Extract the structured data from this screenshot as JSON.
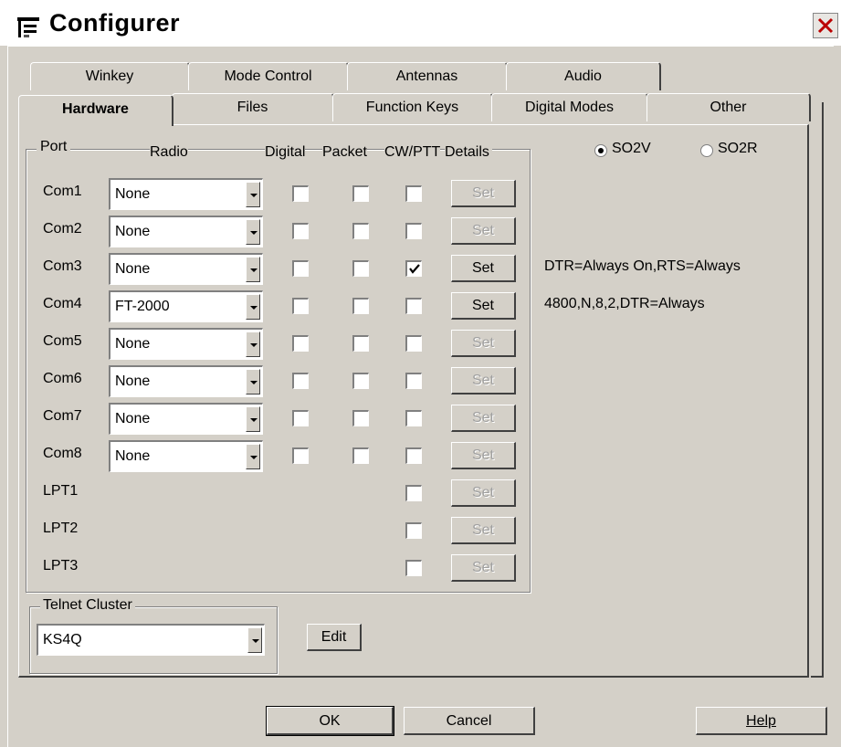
{
  "window": {
    "title": "Configurer",
    "icon": "app-icon"
  },
  "tabs": {
    "back_row": [
      "Winkey",
      "Mode Control",
      "Antennas",
      "Audio"
    ],
    "front_row": [
      "Hardware",
      "Files",
      "Function Keys",
      "Digital Modes",
      "Other"
    ],
    "active": "Hardware"
  },
  "ports_group": {
    "headers": {
      "port": "Port",
      "radio": "Radio",
      "digital": "Digital",
      "packet": "Packet",
      "cwptt": "CW/PTT",
      "details": "Details"
    },
    "rows": [
      {
        "port": "Com1",
        "radio": "None",
        "digital": false,
        "packet": false,
        "cwptt": false,
        "enabled": false,
        "set": "Set",
        "details": ""
      },
      {
        "port": "Com2",
        "radio": "None",
        "digital": false,
        "packet": false,
        "cwptt": false,
        "enabled": false,
        "set": "Set",
        "details": ""
      },
      {
        "port": "Com3",
        "radio": "None",
        "digital": false,
        "packet": false,
        "cwptt": true,
        "enabled": true,
        "set": "Set",
        "details": "DTR=Always On,RTS=Always"
      },
      {
        "port": "Com4",
        "radio": "FT-2000",
        "digital": false,
        "packet": false,
        "cwptt": false,
        "enabled": true,
        "set": "Set",
        "details": "4800,N,8,2,DTR=Always"
      },
      {
        "port": "Com5",
        "radio": "None",
        "digital": false,
        "packet": false,
        "cwptt": false,
        "enabled": false,
        "set": "Set",
        "details": ""
      },
      {
        "port": "Com6",
        "radio": "None",
        "digital": false,
        "packet": false,
        "cwptt": false,
        "enabled": false,
        "set": "Set",
        "details": ""
      },
      {
        "port": "Com7",
        "radio": "None",
        "digital": false,
        "packet": false,
        "cwptt": false,
        "enabled": false,
        "set": "Set",
        "details": ""
      },
      {
        "port": "Com8",
        "radio": "None",
        "digital": false,
        "packet": false,
        "cwptt": false,
        "enabled": false,
        "set": "Set",
        "details": ""
      },
      {
        "port": "LPT1",
        "cwptt": false,
        "enabled": false,
        "set": "Set"
      },
      {
        "port": "LPT2",
        "cwptt": false,
        "enabled": false,
        "set": "Set"
      },
      {
        "port": "LPT3",
        "cwptt": false,
        "enabled": false,
        "set": "Set"
      }
    ]
  },
  "mode": {
    "options": [
      "SO2V",
      "SO2R"
    ],
    "selected": "SO2V"
  },
  "telnet": {
    "label": "Telnet Cluster",
    "value": "KS4Q",
    "edit_label": "Edit"
  },
  "buttons": {
    "ok": "OK",
    "cancel": "Cancel",
    "help": "Help"
  }
}
